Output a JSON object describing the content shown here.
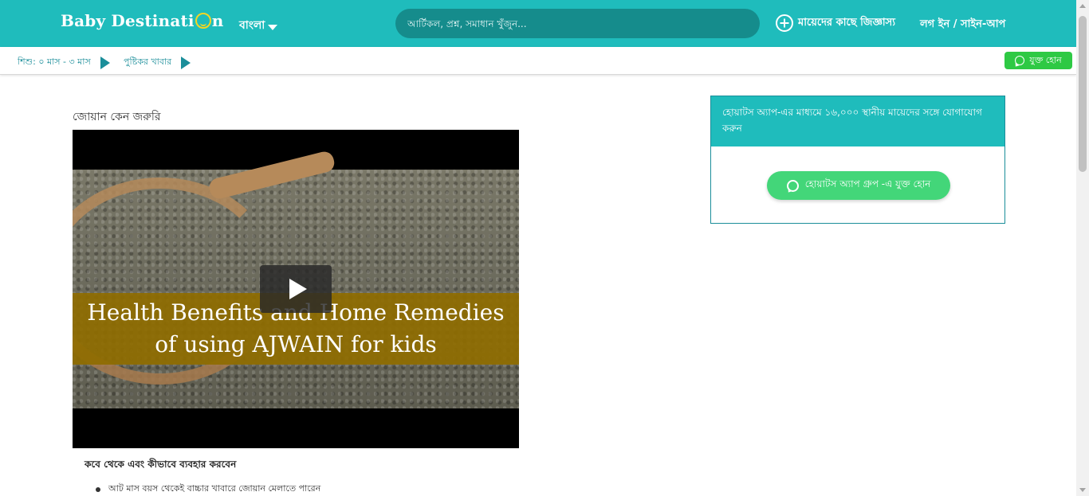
{
  "header": {
    "logo_part1": "Baby Destinati",
    "logo_part2": "n",
    "language": "বাংলা",
    "search_placeholder": "আর্টিকল, প্রশ্ন, সমাধান খুঁজুন...",
    "ask_label": "মায়েদের কাছে জিজ্ঞাস্য",
    "login_label": "লগ ইন / সাইন-আপ"
  },
  "subnav": {
    "crumbs": [
      "শিশু: ০ মাস - ৩ মাস",
      "পুষ্টিকর খাবার"
    ],
    "join_label": "যুক্ত হোন"
  },
  "article": {
    "title": "জোয়ান কেন জরুরি",
    "video": {
      "caption_line1": "Health Benefits and Home Remedies",
      "caption_line2": "of using AJWAIN for kids"
    },
    "sub_heading": "কবে থেকে এবং কীভাবে ব্যবহার করবেন",
    "bullets": [
      "আট মাস বয়স থেকেই বাচ্চার খাবারে জোয়ান মেলাতে পারেন"
    ]
  },
  "sidebar": {
    "card_text": "হোয়াটস অ্যাপ-এর মাধ্যমে ১৬,০০০ স্থানীয় মায়েদের সঙ্গে যোগাযোগ করুন",
    "button_label": "হোয়াটস অ্যাপ গ্রুপ -এ যুক্ত হোন"
  },
  "colors": {
    "brand_teal": "#1fbcbc",
    "whatsapp_green": "#2ec944",
    "logo_yellow": "#f4d623"
  }
}
